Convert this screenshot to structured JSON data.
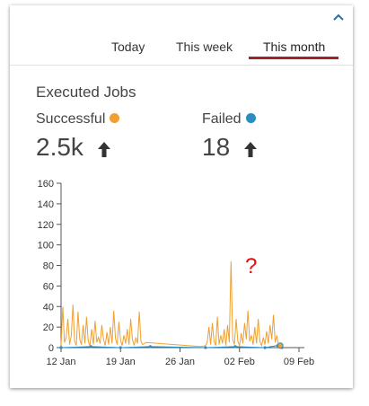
{
  "tabs": [
    {
      "label": "Today",
      "active": false
    },
    {
      "label": "This week",
      "active": false
    },
    {
      "label": "This month",
      "active": true
    }
  ],
  "section_title": "Executed Jobs",
  "metrics": [
    {
      "label": "Successful",
      "value": "2.5k",
      "color": "#f0a030",
      "trend": "up"
    },
    {
      "label": "Failed",
      "value": "18",
      "color": "#2a8dc0",
      "trend": "up"
    }
  ],
  "annotation": "?",
  "colors": {
    "accent_underline": "#a0222b",
    "successful": "#f0a030",
    "failed": "#2a8dc0",
    "annotation": "#e01010"
  },
  "chart_data": {
    "type": "line",
    "xlabel": "",
    "ylabel": "",
    "ylim": [
      0,
      160
    ],
    "xlim": [
      "2022-01-12",
      "2022-02-09"
    ],
    "y_ticks": [
      "0",
      "20",
      "40",
      "60",
      "80",
      "100",
      "120",
      "140",
      "160"
    ],
    "x_ticks": [
      "12 Jan",
      "19 Jan",
      "26 Jan",
      "02 Feb",
      "09 Feb"
    ],
    "series": [
      {
        "name": "Successful",
        "color": "#f0a030",
        "x": [
          0,
          0.2,
          0.4,
          0.6,
          0.8,
          1.0,
          1.2,
          1.4,
          1.6,
          1.8,
          2.0,
          2.2,
          2.4,
          2.6,
          2.8,
          3.0,
          3.2,
          3.4,
          3.6,
          3.8,
          4.0,
          4.2,
          4.4,
          4.6,
          4.8,
          5.0,
          5.2,
          5.4,
          5.6,
          5.8,
          6.0,
          6.2,
          6.4,
          6.6,
          6.8,
          7.0,
          7.2,
          7.4,
          7.6,
          7.8,
          8.0,
          8.2,
          8.4,
          8.6,
          8.8,
          9.0,
          9.2,
          9.4,
          9.6,
          9.8,
          10.0,
          16.5,
          17.0,
          17.2,
          17.4,
          17.6,
          17.8,
          18.0,
          18.2,
          18.4,
          18.6,
          18.8,
          19.0,
          19.2,
          19.4,
          19.6,
          19.8,
          20.0,
          20.2,
          20.4,
          20.6,
          20.8,
          21.0,
          21.2,
          21.4,
          21.6,
          21.8,
          22.0,
          22.2,
          22.4,
          22.6,
          22.8,
          23.0,
          23.2,
          23.4,
          23.6,
          23.8,
          24.0,
          24.2,
          24.4,
          24.6,
          24.8,
          25.0,
          25.2,
          25.4,
          25.6,
          26.0
        ],
        "values": [
          2,
          40,
          5,
          10,
          28,
          3,
          12,
          42,
          6,
          2,
          35,
          8,
          3,
          22,
          4,
          30,
          6,
          2,
          18,
          3,
          26,
          5,
          10,
          4,
          22,
          8,
          2,
          15,
          3,
          20,
          4,
          36,
          9,
          3,
          25,
          7,
          2,
          12,
          4,
          18,
          3,
          28,
          8,
          2,
          10,
          4,
          35,
          6,
          3,
          4,
          5,
          1,
          2,
          5,
          20,
          3,
          24,
          6,
          2,
          30,
          3,
          12,
          4,
          18,
          2,
          22,
          5,
          84,
          8,
          3,
          28,
          6,
          2,
          14,
          4,
          24,
          8,
          36,
          6,
          12,
          3,
          20,
          4,
          28,
          6,
          2,
          10,
          3,
          16,
          4,
          22,
          8,
          32,
          5,
          12,
          2,
          0
        ],
        "x_unit": "days since 2022-01-12"
      },
      {
        "name": "Failed",
        "color": "#2a8dc0",
        "x": [
          0,
          3.5,
          7.0,
          10.5,
          17.0,
          20.5,
          24.0,
          25.5,
          26.0
        ],
        "values": [
          0,
          1,
          0,
          1,
          0,
          1,
          0,
          2,
          0
        ]
      }
    ]
  }
}
